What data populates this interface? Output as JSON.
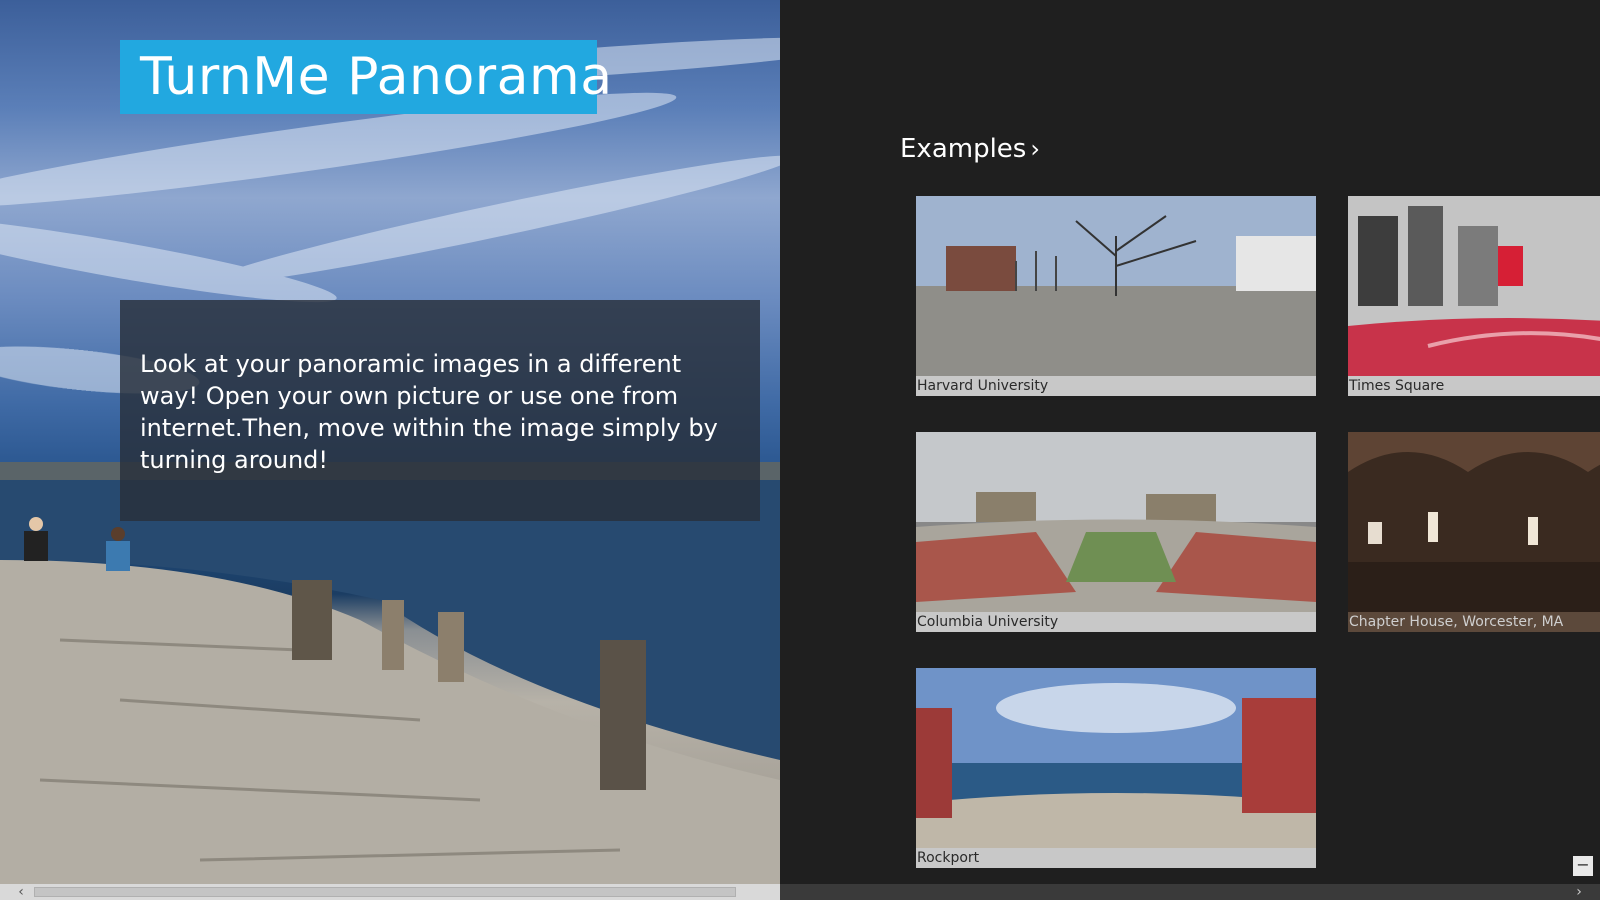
{
  "app": {
    "title": "TurnMe Panorama",
    "description": "Look at your panoramic images in a different way! Open your own picture or use one from internet.Then, move within the image simply by turning around!"
  },
  "examples": {
    "header": "Examples",
    "chevron": "›",
    "tiles": [
      {
        "caption": "Harvard University"
      },
      {
        "caption": "Times Square"
      },
      {
        "caption": "Columbia University"
      },
      {
        "caption": "Chapter House, Worcester, MA"
      },
      {
        "caption": "Rockport"
      }
    ]
  },
  "controls": {
    "zoom_out": "−",
    "scroll_left": "‹",
    "scroll_right": "›"
  },
  "colors": {
    "accent": "#22a8e0",
    "background": "#1f1f1f"
  }
}
